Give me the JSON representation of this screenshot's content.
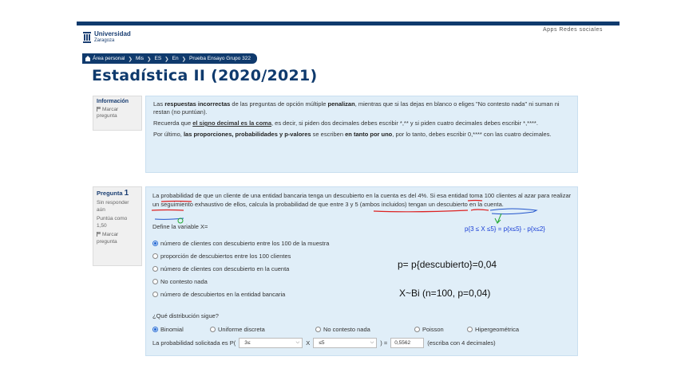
{
  "header": {
    "logo_line1": "Universidad",
    "logo_line2": "Zaragoza",
    "links": "Apps  Redes sociales"
  },
  "breadcrumb": [
    "Área personal",
    "Mis",
    "ES",
    "En",
    "Prueba Ensayo Grupo 322"
  ],
  "page_title": "Estadística II (2020/2021)",
  "info_block": {
    "side_title": "Información",
    "flag_label": "Marcar pregunta",
    "p1": {
      "t1": "Las ",
      "b1": "respuestas incorrectas",
      "t2": " de las preguntas de opción múltiple ",
      "b2": "penalizan",
      "t3": ", mientras que si las dejas en blanco o eliges \"No contesto nada\" ni suman ni restan (no puntúan)."
    },
    "p2": {
      "t1": "Recuerda que ",
      "u1": "el signo decimal es la coma",
      "t2": ", es decir, si piden dos decimales debes escribir *,** y si piden cuatro decimales debes escribir *,****."
    },
    "p3": {
      "t1": "Por último, ",
      "b1": "las proporciones, probabilidades y p-valores",
      "t2": " se escriben ",
      "b2": "en tanto por uno",
      "t3": ", por lo tanto, debes escribir 0,**** con las cuatro decimales."
    }
  },
  "question": {
    "side_title": "Pregunta",
    "number": "1",
    "status": "Sin responder aún",
    "score": "Puntúa como 1,50",
    "flag_label": "Marcar pregunta",
    "text": "La probabilidad de que un cliente de una entidad bancaria tenga un descubierto en la cuenta es del 4%. Si esa entidad toma 100 clientes al azar para realizar un seguimiento exhaustivo de ellos, calcula la probabilidad de que entre 3 y 5 (ambos incluidos) tengan un descubierto en la cuenta.",
    "define_prompt": "Define la variable X=",
    "define_options": [
      "número de clientes con descubierto entre los 100 de la muestra",
      "proporción de descubiertos entre los 100 clientes",
      "número de clientes con descubierto en la cuenta",
      "No contesto nada",
      "número de descubiertos en la entidad bancaria"
    ],
    "dist_prompt": "¿Qué distribución sigue?",
    "dist_options": [
      "Binomial",
      "Uniforme discreta",
      "No contesto nada",
      "Poisson",
      "Hipergeométrica"
    ],
    "prob_label_pre": "La probabilidad solicitada es P(",
    "select1": "3≤",
    "prob_x": "X",
    "select2": "≤5",
    "prob_eq": ") =",
    "answer": "0,5562",
    "hint": "(escriba con 4 decimales)"
  },
  "annotations": {
    "a1": "p{3 ≤ X ≤5} = p{x≤5} - p{x≤2}",
    "a2": "p= p{descubierto}=0,04",
    "a3": "X~Bi (n=100, p=0,04)"
  }
}
